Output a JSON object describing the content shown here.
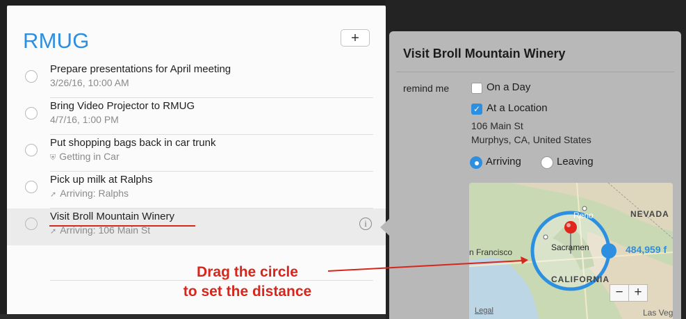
{
  "list": {
    "title": "RMUG",
    "add_label": "+",
    "items": [
      {
        "title": "Prepare presentations for April meeting",
        "subtitle": "3/26/16, 10:00 AM",
        "icon": ""
      },
      {
        "title": "Bring Video Projector to RMUG",
        "subtitle": "4/7/16, 1:00 PM",
        "icon": ""
      },
      {
        "title": "Put shopping bags back in car trunk",
        "subtitle": "Getting in Car",
        "icon": "car-icon"
      },
      {
        "title": "Pick up milk at Ralphs",
        "subtitle": "Arriving: Ralphs",
        "icon": "location-arrow-icon"
      },
      {
        "title": "Visit Broll Mountain Winery",
        "subtitle": "Arriving: 106 Main St",
        "icon": "location-arrow-icon",
        "selected": true
      }
    ],
    "info_glyph": "i"
  },
  "annotation": {
    "line1": "Drag the circle",
    "line2": "to set the distance",
    "color": "#d7261c"
  },
  "detail": {
    "title": "Visit Broll Mountain Winery",
    "remind_label": "remind me",
    "on_a_day": {
      "label": "On a Day",
      "checked": false
    },
    "at_location": {
      "label": "At a Location",
      "checked": true
    },
    "address_line1": "106 Main St",
    "address_line2": "Murphys, CA, United States",
    "arriving": {
      "label": "Arriving",
      "selected": true
    },
    "leaving": {
      "label": "Leaving",
      "selected": false
    },
    "map": {
      "labels": {
        "nevada": "NEVADA",
        "reno": "Reno",
        "san_francisco": "n Francisco",
        "sacramento": "Sacramen",
        "california": "CALIFORNIA",
        "las_vegas": "Las Veg",
        "legal": "Legal"
      },
      "radius_label": "484,959 f",
      "zoom_out": "−",
      "zoom_in": "+"
    }
  },
  "colors": {
    "accent": "#2d8fe0",
    "annotation": "#d7261c",
    "popover": "#b8b8b8"
  }
}
